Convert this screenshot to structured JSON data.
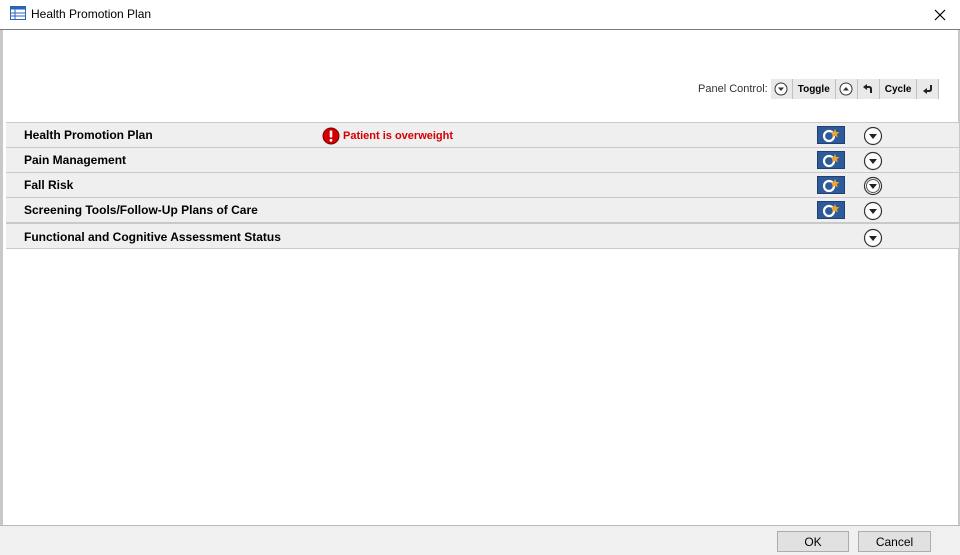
{
  "window": {
    "title": "Health Promotion Plan",
    "title_icon": "table-icon",
    "close_icon": "close-icon"
  },
  "panel_control": {
    "label": "Panel Control:",
    "toggle_label": "Toggle",
    "cycle_label": "Cycle",
    "icons": [
      "expand-all-icon",
      "collapse-all-icon",
      "cycle-back-icon",
      "cycle-forward-icon"
    ]
  },
  "sections": [
    {
      "title": "Health Promotion Plan",
      "alert": "Patient is overweight",
      "has_launch": true
    },
    {
      "title": "Pain Management",
      "has_launch": true
    },
    {
      "title": "Fall Risk",
      "has_launch": true
    },
    {
      "title": "Screening Tools/Follow-Up Plans of Care",
      "has_launch": true
    },
    {
      "title": "Functional and Cognitive Assessment Status",
      "has_launch": false
    }
  ],
  "footer": {
    "ok_label": "OK",
    "cancel_label": "Cancel"
  },
  "colors": {
    "alert": "#d40000",
    "launch_button": "#2d5a9a",
    "section_bg": "#efefef"
  }
}
